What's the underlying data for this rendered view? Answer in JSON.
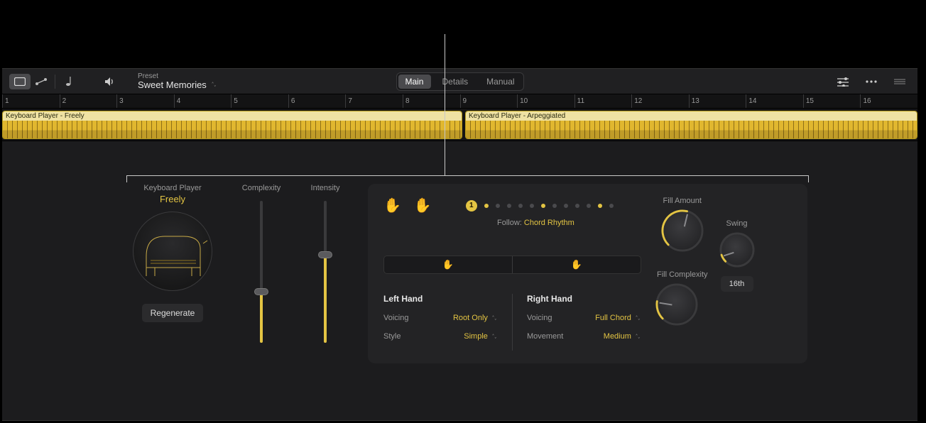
{
  "toolbar": {
    "preset_label": "Preset",
    "preset_name": "Sweet Memories"
  },
  "tabs": {
    "main": "Main",
    "details": "Details",
    "manual": "Manual",
    "active": "Main"
  },
  "ruler": {
    "bars": [
      "1",
      "2",
      "3",
      "4",
      "5",
      "6",
      "7",
      "8",
      "9",
      "10",
      "11",
      "12",
      "13",
      "14",
      "15",
      "16"
    ]
  },
  "regions": [
    {
      "name": "Keyboard Player - Freely",
      "start": 0,
      "end": 648
    },
    {
      "name": "Keyboard Player - Arpeggiated",
      "start": 652,
      "end": 1289
    }
  ],
  "player": {
    "label": "Keyboard Player",
    "name": "Freely",
    "regenerate": "Regenerate"
  },
  "sliders": {
    "complexity": {
      "label": "Complexity",
      "value_pct": 36
    },
    "intensity": {
      "label": "Intensity",
      "value_pct": 62
    }
  },
  "pattern": {
    "slot_badge": "1",
    "dots": [
      true,
      false,
      false,
      false,
      false,
      true,
      false,
      false,
      false,
      false,
      true,
      false
    ],
    "follow_label": "Follow:",
    "follow_value": "Chord Rhythm"
  },
  "hands": {
    "left": {
      "title": "Left Hand",
      "voicing_label": "Voicing",
      "voicing_value": "Root Only",
      "style_label": "Style",
      "style_value": "Simple"
    },
    "right": {
      "title": "Right Hand",
      "voicing_label": "Voicing",
      "voicing_value": "Full Chord",
      "movement_label": "Movement",
      "movement_value": "Medium"
    }
  },
  "knobs": {
    "fill_amount": {
      "label": "Fill Amount",
      "value_pct": 55
    },
    "fill_complexity": {
      "label": "Fill Complexity",
      "value_pct": 20
    },
    "swing": {
      "label": "Swing",
      "value_pct": 10
    },
    "swing_division": "16th"
  }
}
